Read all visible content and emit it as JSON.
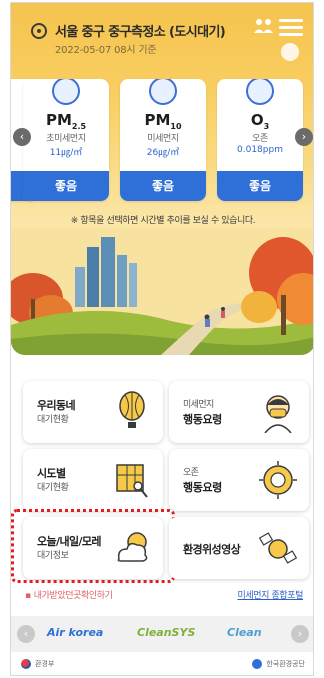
{
  "header": {
    "station_name": "서울 중구 중구측정소 (도시대기)",
    "updated_time": "2022-05-07 08시 기준"
  },
  "pollutants": [
    {
      "title": "PM25",
      "title_main": "PM",
      "title_subscript": "2.5",
      "subtitle": "초미세먼지",
      "value": "11㎍/㎥",
      "grade": "좋음"
    },
    {
      "title": "PM10",
      "title_main": "PM",
      "title_subscript": "10",
      "subtitle": "미세먼지",
      "value": "26㎍/㎥",
      "grade": "좋음"
    },
    {
      "title": "O3",
      "title_main": "O",
      "title_subscript": "3",
      "subtitle": "오존",
      "value": "0.018ppm",
      "grade": "좋음"
    }
  ],
  "notice": "※ 항목을 선택하면 시간별 추이를 보실 수 있습니다.",
  "menu": {
    "tiles": [
      {
        "title": "우리동네",
        "subtitle": "대기현황",
        "icon": "balloon-icon"
      },
      {
        "title": "미세먼지",
        "subtitle": "행동요령",
        "icon": "mask-person-icon"
      },
      {
        "title": "시도별",
        "subtitle": "대기현황",
        "icon": "map-icon"
      },
      {
        "title": "오존",
        "subtitle": "행동요령",
        "icon": "sun-icon"
      },
      {
        "title": "오늘/내일/모레",
        "subtitle": "대기정보",
        "icon": "cloud-sun-icon"
      },
      {
        "title": "환경위성영상",
        "subtitle": "",
        "icon": "satellite-icon"
      }
    ]
  },
  "links": {
    "left": "내가받았던곳확인하기",
    "right": "미세먼지 종합포털"
  },
  "partners": [
    "Air korea",
    "CleanSYS",
    "Clean"
  ],
  "footer": {
    "left": "환경부",
    "right": "한국환경공단"
  },
  "colors": {
    "accent": "#2f6fd8",
    "grade_good": "#2f6fd8",
    "highlight": "#e11d1d",
    "hero_yellow": "#f6c34e"
  }
}
